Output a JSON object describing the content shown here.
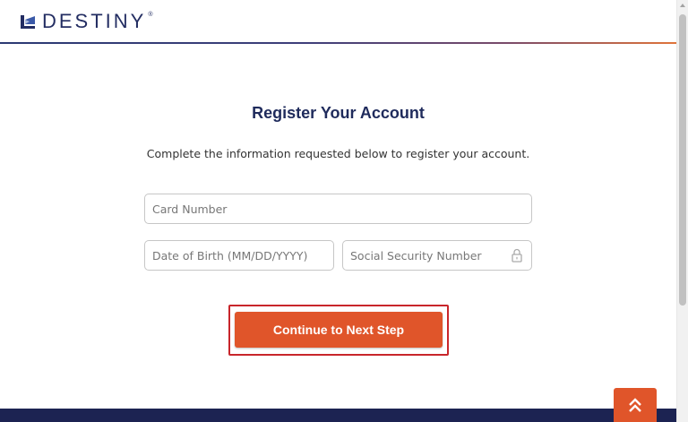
{
  "brand": {
    "name": "DESTINY",
    "registered_mark": "®",
    "colors": {
      "navy": "#232d62",
      "orange": "#e0552a"
    }
  },
  "form": {
    "title": "Register Your Account",
    "subtitle": "Complete the information requested below to register your account.",
    "card_number_placeholder": "Card Number",
    "dob_placeholder": "Date of Birth (MM/DD/YYYY)",
    "ssn_placeholder": "Social Security Number",
    "continue_label": "Continue to Next Step"
  },
  "icons": {
    "lock": "lock-icon",
    "back_to_top": "double-chevron-up-icon",
    "logo": "destiny-logo-mark-icon"
  }
}
